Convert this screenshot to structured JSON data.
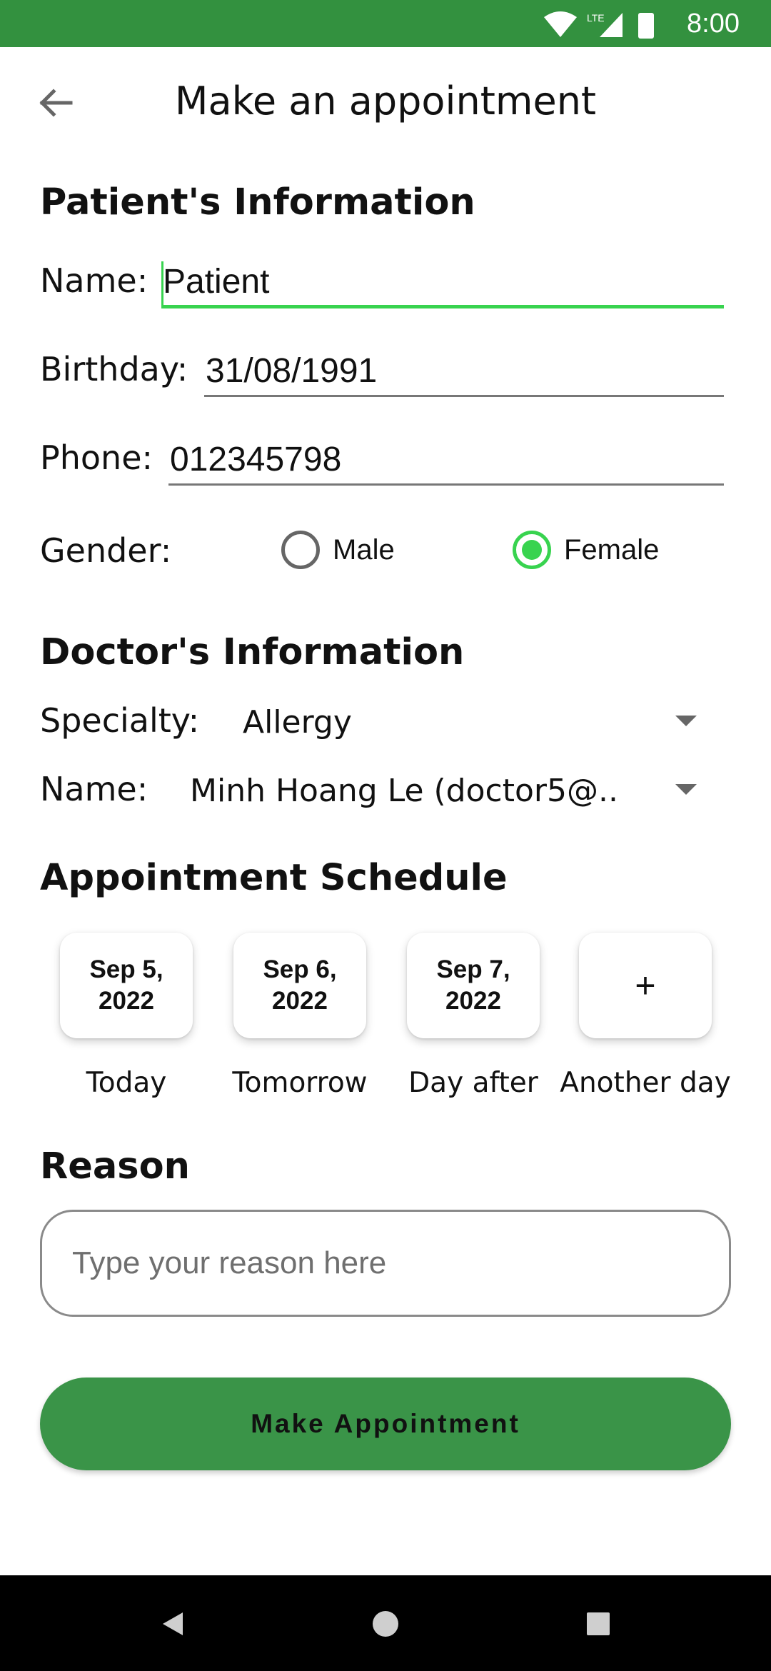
{
  "status_bar": {
    "time": "8:00",
    "network": "LTE",
    "color": "#33913f"
  },
  "header": {
    "title": "Make an appointment",
    "back_icon": "arrow-left-icon"
  },
  "patient": {
    "section_title": "Patient's Information",
    "name_label": "Name:",
    "name_value": "Patient",
    "birthday_label": "Birthday:",
    "birthday_value": "31/08/1991",
    "phone_label": "Phone:",
    "phone_value": "012345798",
    "gender_label": "Gender:",
    "gender_options": [
      "Male",
      "Female"
    ],
    "gender_selected": "Female"
  },
  "doctor": {
    "section_title": "Doctor's Information",
    "specialty_label": "Specialty:",
    "specialty_value": "Allergy",
    "name_label": "Name:",
    "name_value": "Minh Hoang Le (doctor5@.."
  },
  "schedule": {
    "section_title": "Appointment Schedule",
    "dates": [
      {
        "date": "Sep 5,\n2022",
        "caption": "Today"
      },
      {
        "date": "Sep 6,\n2022",
        "caption": "Tomorrow"
      },
      {
        "date": "Sep 7,\n2022",
        "caption": "Day after"
      },
      {
        "date": "+",
        "caption": "Another day"
      }
    ]
  },
  "reason": {
    "section_title": "Reason",
    "placeholder": "Type your reason here"
  },
  "submit": {
    "label": "Make Appointment"
  },
  "colors": {
    "accent": "#38d34f",
    "brand_green": "#3a9448",
    "nav_bar": "#000000"
  }
}
